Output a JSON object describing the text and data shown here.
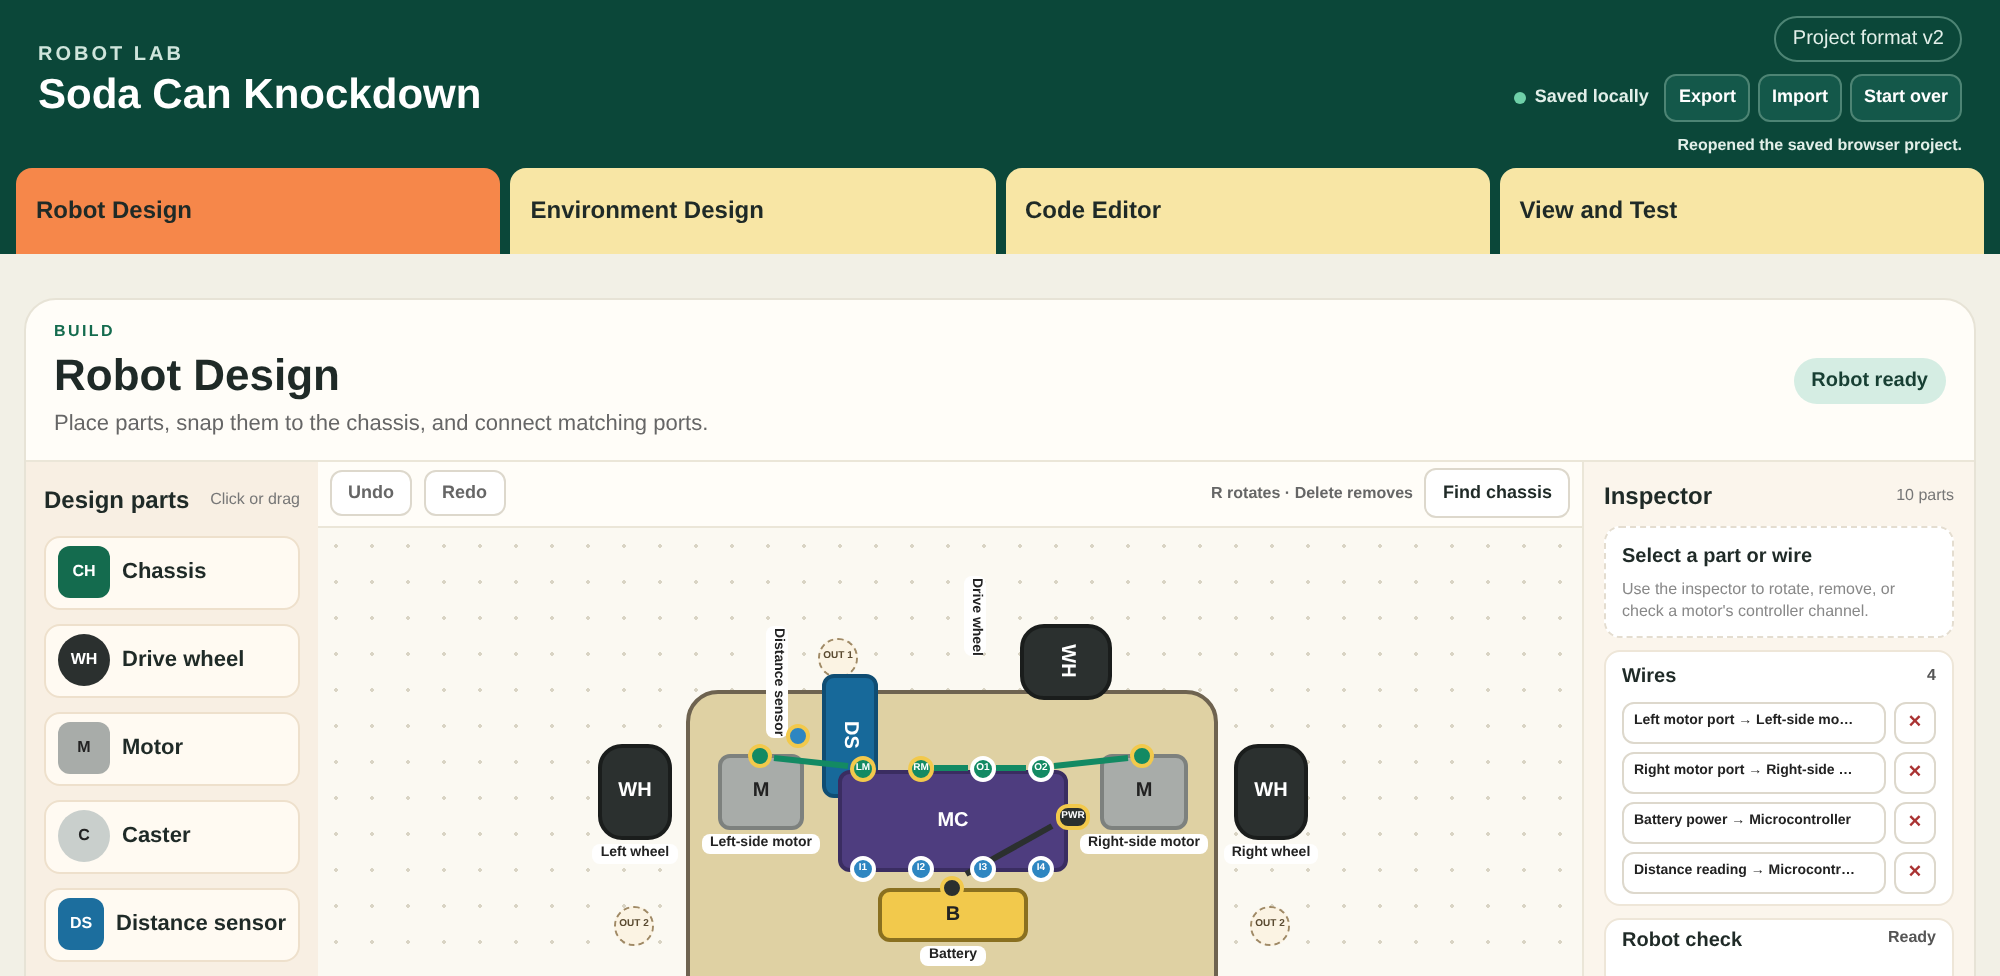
{
  "header": {
    "eyebrow": "ROBOT LAB",
    "title": "Soda Can Knockdown",
    "format": "Project format v2",
    "save_status": "Saved locally",
    "saved": true,
    "buttons": [
      "Export",
      "Import",
      "Start over"
    ],
    "message": "Reopened the saved browser project."
  },
  "tabs": [
    {
      "label": "Robot Design",
      "selected": true
    },
    {
      "label": "Environment Design",
      "selected": false
    },
    {
      "label": "Code Editor",
      "selected": false
    },
    {
      "label": "View and Test",
      "selected": false
    }
  ],
  "page": {
    "eyebrow": "BUILD",
    "title": "Robot Design",
    "description": "Place parts, snap them to the chassis, and connect matching ports.",
    "status": "Robot ready"
  },
  "parts_panel": {
    "title": "Design parts",
    "hint": "Click or drag",
    "items": [
      {
        "code": "CH",
        "label": "Chassis",
        "kind": "square",
        "color": "#146b4e"
      },
      {
        "code": "WH",
        "label": "Drive wheel",
        "kind": "round",
        "color": "#2b302f"
      },
      {
        "code": "M",
        "label": "Motor",
        "kind": "square",
        "color": "#a8aca9"
      },
      {
        "code": "C",
        "label": "Caster",
        "kind": "round",
        "color": "#c9cfcc"
      },
      {
        "code": "DS",
        "label": "Distance sensor",
        "kind": "square",
        "color": "#1c6e9e"
      }
    ]
  },
  "toolbar": {
    "buttons": [
      "Undo",
      "Redo"
    ],
    "hint": "R rotates · Delete removes",
    "action": "Find chassis"
  },
  "canvas": {
    "parts": [
      {
        "code": "WH",
        "label": "Left wheel",
        "kind": "wheel",
        "rotated": false
      },
      {
        "code": "M",
        "label": "Left-side motor",
        "kind": "motor",
        "rotated": false
      },
      {
        "code": "DS",
        "label": "Distance sensor",
        "kind": "sensor",
        "rotated": true
      },
      {
        "code": "WH",
        "label": "Drive wheel",
        "kind": "wheel",
        "rotated": true
      },
      {
        "code": "MC",
        "kind": "controller",
        "rotated": false
      },
      {
        "code": "M",
        "label": "Right-side motor",
        "kind": "motor",
        "rotated": false
      },
      {
        "code": "WH",
        "label": "Right wheel",
        "kind": "wheel",
        "rotated": false
      },
      {
        "code": "B",
        "label": "Battery",
        "kind": "battery",
        "rotated": false
      }
    ],
    "ports": [
      {
        "label": "LM",
        "kind": "motor"
      },
      {
        "label": "RM",
        "kind": "motor"
      },
      {
        "label": "O1",
        "kind": "output"
      },
      {
        "label": "O2",
        "kind": "output"
      },
      {
        "label": "I1",
        "kind": "input"
      },
      {
        "label": "I2",
        "kind": "input"
      },
      {
        "label": "I3",
        "kind": "input"
      },
      {
        "label": "I4",
        "kind": "input"
      },
      {
        "label": "PWR",
        "kind": "power"
      }
    ],
    "slots": [
      "OUT 1",
      "OUT 2",
      "OUT 2"
    ]
  },
  "inspector": {
    "title": "Inspector",
    "count": "10 parts",
    "empty_title": "Select a part or wire",
    "empty_text": "Use the inspector to rotate, remove, or check a motor's controller channel.",
    "wires_title": "Wires",
    "wires_count": "4",
    "wires": [
      {
        "label": "Left motor port → Left-side mo…",
        "remove": "×"
      },
      {
        "label": "Right motor port → Right-side …",
        "remove": "×"
      },
      {
        "label": "Battery power → Microcontroller",
        "remove": "×"
      },
      {
        "label": "Distance reading → Microcontr…",
        "remove": "×"
      }
    ],
    "check_title": "Robot check",
    "check_status": "Ready"
  }
}
